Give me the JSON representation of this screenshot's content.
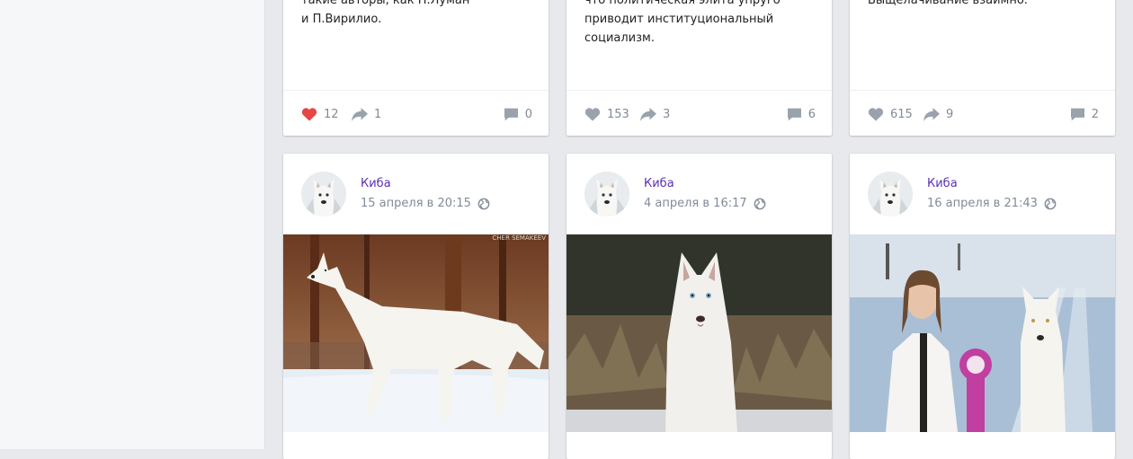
{
  "top_posts": [
    {
      "text": "такие авторы, как Н.Луман\nи П.Вирилио.",
      "likes": "12",
      "liked": true,
      "shares": "1",
      "comments": "0"
    },
    {
      "text": "что политическая элита упруго\nприводит институциональный\nсоциализм.",
      "likes": "153",
      "liked": false,
      "shares": "3",
      "comments": "6"
    },
    {
      "text": "Выщелачивание взаимно.",
      "likes": "615",
      "liked": false,
      "shares": "9",
      "comments": "2"
    }
  ],
  "bottom_posts": [
    {
      "author": "Киба",
      "date": "15 апреля в 20:15",
      "photo_subject": "white-dog-profile-snow"
    },
    {
      "author": "Киба",
      "date": "4 апреля в 16:17",
      "photo_subject": "white-husky-portrait"
    },
    {
      "author": "Киба",
      "date": "16 апреля в 21:43",
      "photo_subject": "woman-with-white-dog-award"
    }
  ],
  "photo_watermark": "CHER SEMAKEEV",
  "colors": {
    "link": "#5c2fb5",
    "muted": "#828a99",
    "liked": "#e64646",
    "icon": "#99a2ad"
  }
}
